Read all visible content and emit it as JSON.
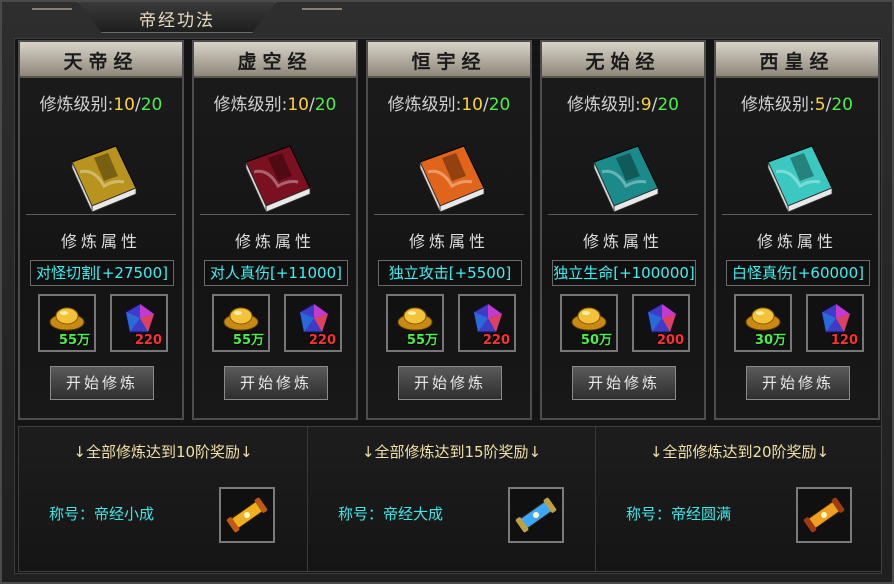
{
  "window": {
    "title": "帝经功法"
  },
  "section_title": "修炼属性",
  "button_label": "开始修炼",
  "level_label": "修炼级别:",
  "cards": [
    {
      "name": "天帝经",
      "level": "10",
      "max": "20",
      "attr": "对怪切割[+27500]",
      "gold": "55万",
      "gem": "220",
      "book_color": "#b8941e"
    },
    {
      "name": "虚空经",
      "level": "10",
      "max": "20",
      "attr": "对人真伤[+11000]",
      "gold": "55万",
      "gem": "220",
      "book_color": "#7a1020"
    },
    {
      "name": "恒宇经",
      "level": "10",
      "max": "20",
      "attr": "独立攻击[+5500]",
      "gold": "55万",
      "gem": "220",
      "book_color": "#e0641a"
    },
    {
      "name": "无始经",
      "level": "9",
      "max": "20",
      "attr": "独立生命[+100000]",
      "gold": "50万",
      "gem": "200",
      "book_color": "#1a8a8a"
    },
    {
      "name": "西皇经",
      "level": "5",
      "max": "20",
      "attr": "白怪真伤[+60000]",
      "gold": "30万",
      "gem": "120",
      "book_color": "#3ac8c0"
    }
  ],
  "rewards": [
    {
      "header": "↓全部修炼达到10阶奖励↓",
      "label": "称号：帝经小成",
      "icon": "golden-scroll-icon"
    },
    {
      "header": "↓全部修炼达到15阶奖励↓",
      "label": "称号：帝经大成",
      "icon": "blue-scroll-icon"
    },
    {
      "header": "↓全部修炼达到20阶奖励↓",
      "label": "称号：帝经圆满",
      "icon": "ornate-scroll-icon"
    }
  ],
  "colors": {
    "gold_count": "#48f048",
    "gem_count": "#ff3030"
  }
}
